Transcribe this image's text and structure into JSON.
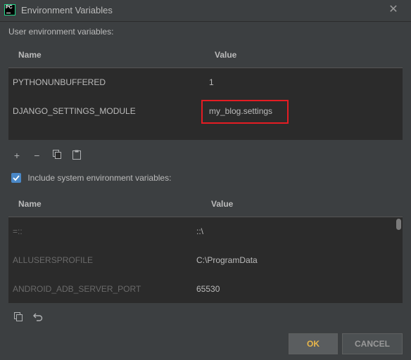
{
  "window": {
    "title": "Environment Variables",
    "app_icon_text": "PC"
  },
  "user_section": {
    "label": "User environment variables:",
    "columns": {
      "name": "Name",
      "value": "Value"
    },
    "rows": [
      {
        "name": "PYTHONUNBUFFERED",
        "value": "1"
      },
      {
        "name": "DJANGO_SETTINGS_MODULE",
        "value": "my_blog.settings"
      }
    ]
  },
  "include_system": {
    "label": "Include system environment variables:",
    "checked": true
  },
  "system_section": {
    "columns": {
      "name": "Name",
      "value": "Value"
    },
    "rows": [
      {
        "name": "=::",
        "value": "::\\"
      },
      {
        "name": "ALLUSERSPROFILE",
        "value": "C:\\ProgramData"
      },
      {
        "name": "ANDROID_ADB_SERVER_PORT",
        "value": "65530"
      }
    ]
  },
  "buttons": {
    "ok": "OK",
    "cancel": "CANCEL"
  },
  "colors": {
    "highlight": "#e51c23",
    "ok_text": "#e8b64a",
    "checkbox": "#4a88c7"
  },
  "icons": {
    "user_toolbar": [
      "add-icon",
      "remove-icon",
      "copy-icon",
      "paste-icon"
    ],
    "system_toolbar": [
      "copy-icon",
      "undo-icon"
    ]
  }
}
